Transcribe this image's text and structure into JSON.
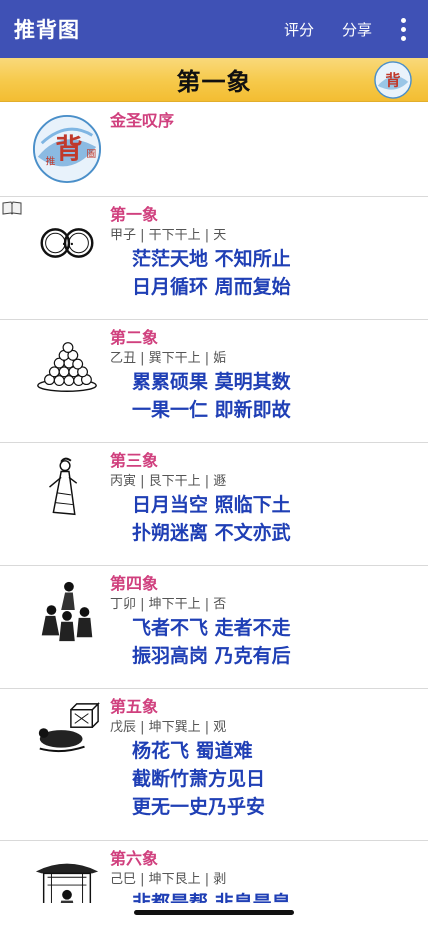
{
  "app": {
    "title": "推背图",
    "rate_label": "评分",
    "share_label": "分享"
  },
  "banner": {
    "title": "第一象",
    "logo_text": "推背圖"
  },
  "preface": {
    "title": "金圣叹序",
    "logo_text": "推背圖"
  },
  "items": [
    {
      "name": "第一象",
      "meta": "甲子 | 干下干上 | 天",
      "verses": [
        "茫茫天地  不知所止",
        "日月循环  周而复始"
      ]
    },
    {
      "name": "第二象",
      "meta": "乙丑 | 巽下干上 | 姤",
      "verses": [
        "累累硕果  莫明其数",
        "一果一仁  即新即故"
      ]
    },
    {
      "name": "第三象",
      "meta": "丙寅 | 艮下干上 | 遯",
      "verses": [
        "日月当空  照临下土",
        "扑朔迷离  不文亦武"
      ]
    },
    {
      "name": "第四象",
      "meta": "丁卯 | 坤下干上 | 否",
      "verses": [
        "飞者不飞  走者不走",
        "振羽高岗  乃克有后"
      ]
    },
    {
      "name": "第五象",
      "meta": "戊辰 | 坤下巽上 | 观",
      "verses": [
        "杨花飞  蜀道难",
        "截断竹萧方见日",
        "更无一史乃乎安"
      ]
    },
    {
      "name": "第六象",
      "meta": "己巳 | 坤下艮上 | 剥",
      "verses": [
        "非都是帮  非皇是皇"
      ]
    }
  ],
  "colors": {
    "appbar": "#3f51b5",
    "item_title": "#d0407e",
    "verse": "#1f3fb5",
    "banner": "#f6c94a"
  }
}
